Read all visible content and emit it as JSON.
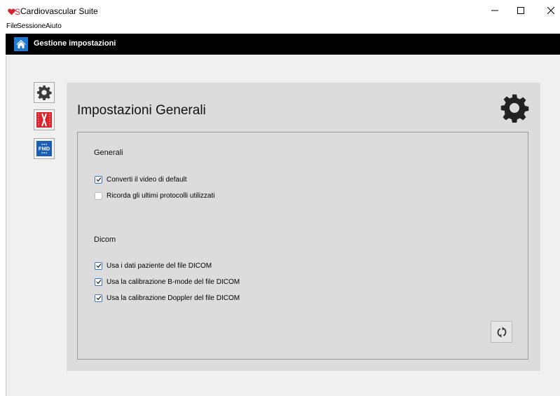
{
  "window": {
    "title": "Cardiovascular Suite",
    "logo_letter": "S",
    "minimize_glyph": "—",
    "maximize_glyph": "☐",
    "close_glyph": "✕"
  },
  "menu": {
    "items": [
      {
        "label": "File"
      },
      {
        "label": "Sessione"
      },
      {
        "label": "Aiuto"
      }
    ]
  },
  "header": {
    "title": "Gestione impostazioni",
    "home_icon": "home-icon"
  },
  "sidebar": {
    "items": [
      {
        "icon": "gear-icon"
      },
      {
        "icon": "cardio-icon"
      },
      {
        "icon": "fmd-icon",
        "label": "FMD"
      }
    ]
  },
  "panel": {
    "title": "Impostazioni Generali",
    "sections": [
      {
        "title": "Generali",
        "options": [
          {
            "label": "Converti il video di default",
            "checked": true
          },
          {
            "label": "Ricorda gli ultimi protocolli utilizzati",
            "checked": false
          }
        ]
      },
      {
        "title": "Dicom",
        "options": [
          {
            "label": "Usa i dati paziente del file DICOM",
            "checked": true
          },
          {
            "label": "Usa la calibrazione B-mode del file DICOM",
            "checked": true
          },
          {
            "label": "Usa la calibrazione Doppler del file DICOM",
            "checked": true
          }
        ]
      }
    ]
  },
  "colors": {
    "brand_red": "#d9232d",
    "accent_blue": "#1f7ad6",
    "header_bg": "#000000",
    "panel_bg": "#dcdcdc"
  }
}
